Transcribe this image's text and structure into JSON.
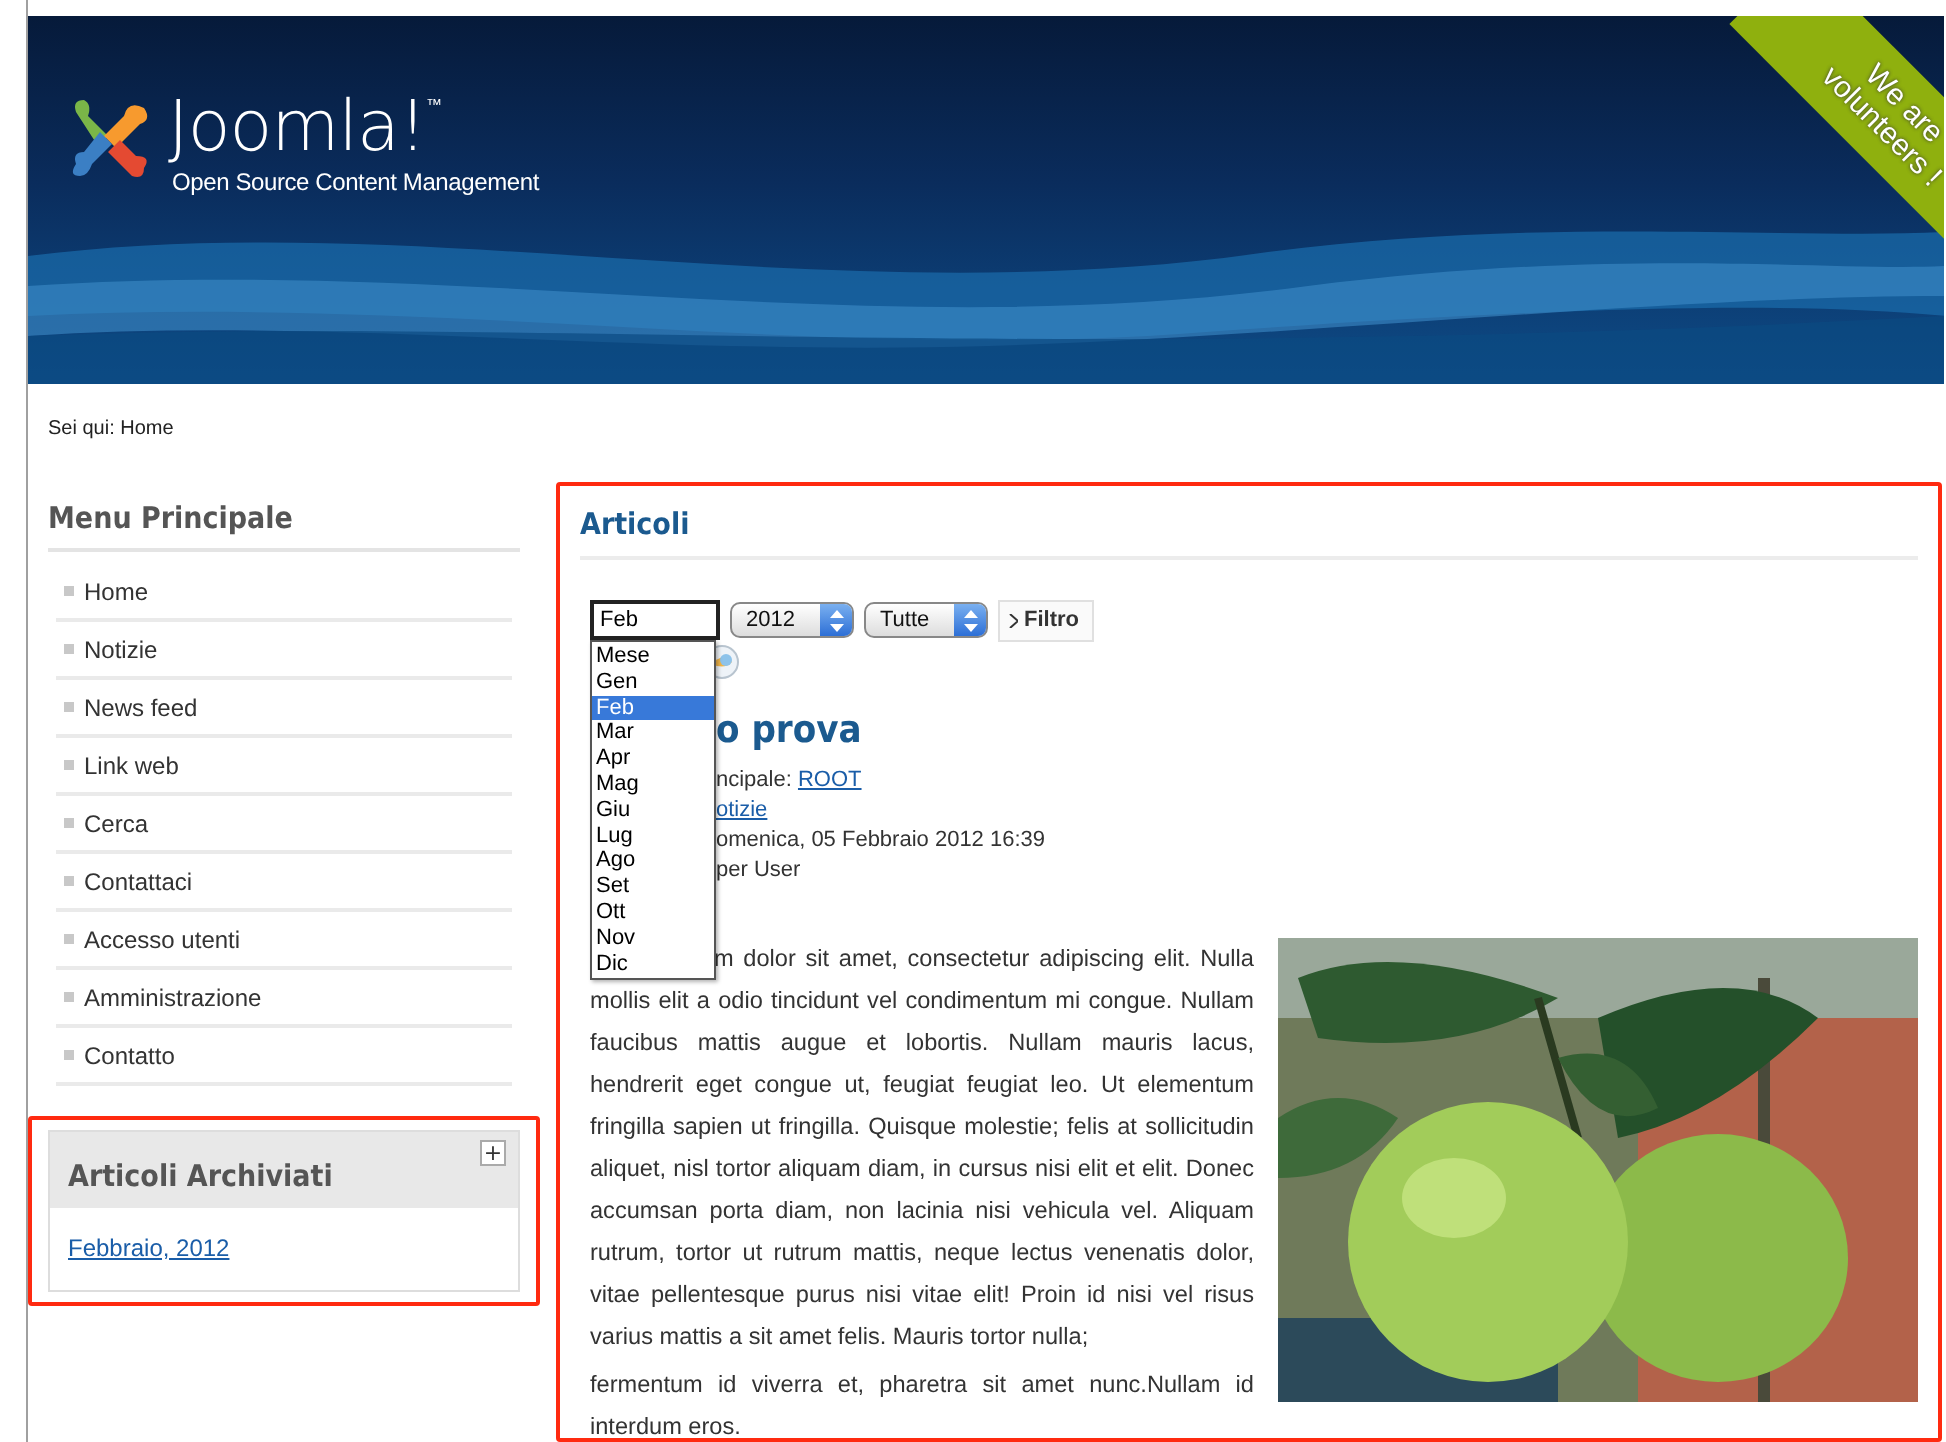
{
  "header": {
    "logo_text": "Joomla!",
    "trademark": "™",
    "tagline": "Open Source Content Management",
    "ribbon": [
      "We are",
      "volunteers !"
    ]
  },
  "breadcrumb": "Sei qui: Home",
  "sidebar": {
    "title": "Menu Principale",
    "items": [
      "Home",
      "Notizie",
      "News feed",
      "Link web",
      "Cerca",
      "Contattaci",
      "Accesso utenti",
      "Amministrazione",
      "Contatto"
    ],
    "archive": {
      "title": "Articoli Archiviati",
      "toggle": "+",
      "links": [
        "Febbraio, 2012"
      ]
    }
  },
  "content": {
    "title": "Articoli",
    "filters": {
      "month": "Feb",
      "year": "2012",
      "type": "Tutte",
      "button": "Filtro"
    },
    "month_dropdown": [
      {
        "label": "Mese",
        "selected": false
      },
      {
        "label": "Gen",
        "selected": false
      },
      {
        "label": "Feb",
        "selected": true
      },
      {
        "label": "Mar",
        "selected": false
      },
      {
        "label": "Apr",
        "selected": false
      },
      {
        "label": "Mag",
        "selected": false
      },
      {
        "label": "Giu",
        "selected": false
      },
      {
        "label": "Lug",
        "selected": false
      },
      {
        "label": "Ago",
        "selected": false
      },
      {
        "label": "Set",
        "selected": false
      },
      {
        "label": "Ott",
        "selected": false
      },
      {
        "label": "Nov",
        "selected": false
      },
      {
        "label": "Dic",
        "selected": false
      }
    ],
    "article": {
      "title": "o prova",
      "meta": [
        {
          "text": "ncipale: ",
          "link": "ROOT"
        },
        {
          "link": "otizie"
        },
        {
          "text": "omenica, 05 Febbraio 2012 16:39"
        },
        {
          "text": "per User"
        }
      ],
      "lead_line": "m dolor sit amet, consectetur adipiscing elit. Nulla",
      "paragraphs": [
        "mollis elit a odio tincidunt vel condimentum mi congue. Nullam faucibus mattis augue et lobortis. Nullam mauris lacus, hendrerit eget congue ut, feugiat feugiat leo. Ut elementum fringilla sapien ut fringilla. Quisque molestie; felis at sollicitudin aliquet, nisl tortor aliquam diam, in cursus nisi elit et elit. Donec accumsan porta diam, non lacinia nisi vehicula vel. Aliquam rutrum, tortor ut rutrum mattis, neque lectus venenatis dolor, vitae pellentesque purus nisi vitae elit! Proin id nisi vel risus varius mattis a sit amet felis. Mauris tortor nulla;",
        "fermentum id viverra et, pharetra sit amet nunc.Nullam id interdum eros."
      ]
    }
  }
}
